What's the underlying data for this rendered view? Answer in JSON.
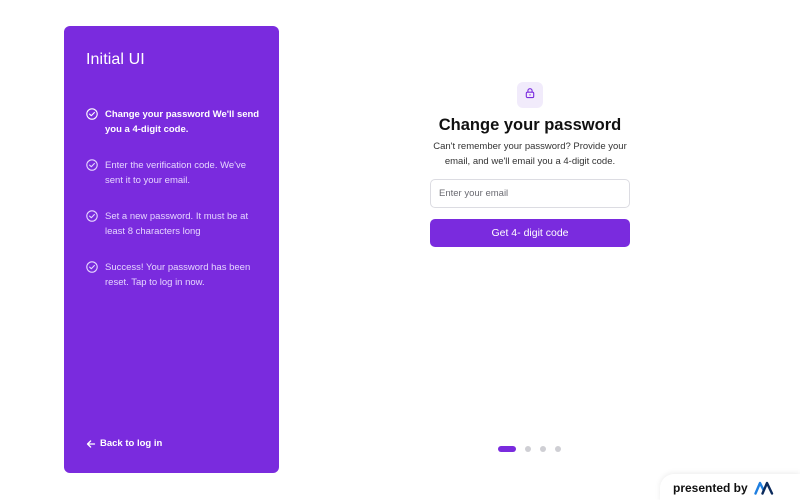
{
  "sidebar": {
    "title": "Initial UI",
    "steps": [
      {
        "text": "Change your password We'll send you a 4-digit code.",
        "active": true
      },
      {
        "text": "Enter the verification code. We've sent it to your email.",
        "active": false
      },
      {
        "text": "Set a new password. It must be at least 8 characters long",
        "active": false
      },
      {
        "text": "Success! Your password has been reset. Tap to log in now.",
        "active": false
      }
    ],
    "back_label": "Back to log in"
  },
  "main": {
    "icon": "lock-icon",
    "title": "Change your password",
    "subtitle": "Can't remember your password? Provide your email, and we'll email you a 4-digit code.",
    "email": {
      "value": "",
      "placeholder": "Enter your email"
    },
    "submit_label": "Get 4- digit code"
  },
  "pager": {
    "total": 4,
    "current": 1
  },
  "footer": {
    "presented_by": "presented by",
    "logo": "brand-logo-icon"
  },
  "colors": {
    "accent": "#7a2bde",
    "accent_light": "#f1ebfb",
    "muted_dot": "#cfcfd4"
  }
}
